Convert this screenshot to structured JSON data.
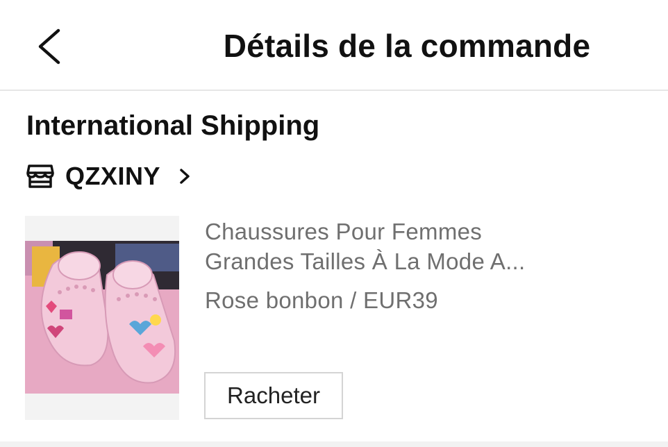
{
  "header": {
    "title": "Détails de la commande",
    "back_icon": "chevron-left-icon"
  },
  "shipping": {
    "title": "International Shipping"
  },
  "store": {
    "icon": "store-icon",
    "name": "QZXINY",
    "chevron_icon": "chevron-right-icon"
  },
  "product": {
    "name_line1": "Chaussures Pour Femmes",
    "name_line2": "Grandes Tailles À La Mode A...",
    "variant": "Rose bonbon / EUR39",
    "image_subject": "pink clogs with charms",
    "rebuy_label": "Racheter"
  },
  "colors": {
    "text_primary": "#111111",
    "text_secondary": "#6f6f6f",
    "divider": "#e6e6e6",
    "shoe_pink": "#f0c4d6"
  }
}
